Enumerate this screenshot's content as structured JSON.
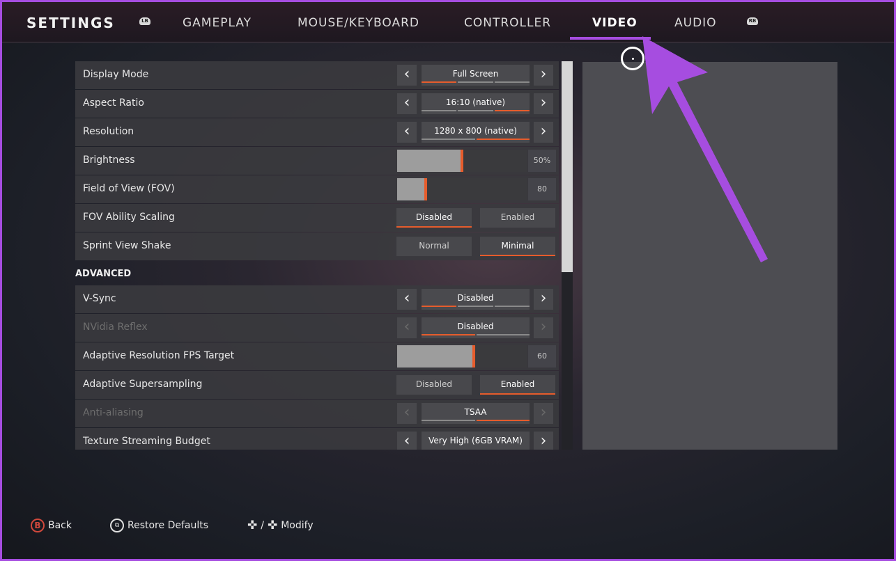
{
  "header": {
    "title": "SETTINGS",
    "left_bumper": "LB",
    "right_bumper": "RB",
    "tabs": [
      {
        "label": "GAMEPLAY"
      },
      {
        "label": "MOUSE/KEYBOARD"
      },
      {
        "label": "CONTROLLER"
      },
      {
        "label": "VIDEO"
      },
      {
        "label": "AUDIO"
      }
    ],
    "active_tab": "VIDEO"
  },
  "colors": {
    "accent": "#e65c2c",
    "annotation": "#a64de0",
    "row_bg": "#3a3a3e",
    "text": "#e6e6e6"
  },
  "settings": {
    "display_mode": {
      "label": "Display Mode",
      "value": "Full Screen",
      "option_count": 3,
      "selected_index": 0
    },
    "aspect_ratio": {
      "label": "Aspect Ratio",
      "value": "16:10 (native)",
      "option_count": 3,
      "selected_index": 2
    },
    "resolution": {
      "label": "Resolution",
      "value": "1280 x 800 (native)",
      "option_count": 2,
      "selected_index": 1
    },
    "brightness": {
      "label": "Brightness",
      "value": "50%",
      "level": 0.5
    },
    "fov": {
      "label": "Field of View (FOV)",
      "value": "80",
      "level": 0.22
    },
    "fov_scaling": {
      "label": "FOV Ability Scaling",
      "option1": "Disabled",
      "option2": "Enabled",
      "selected": 1
    },
    "sprint_shake": {
      "label": "Sprint View Shake",
      "option1": "Normal",
      "option2": "Minimal",
      "selected": 2
    },
    "advanced_heading": "ADVANCED",
    "vsync": {
      "label": "V-Sync",
      "value": "Disabled",
      "option_count": 3,
      "selected_index": 0
    },
    "nvidia_reflex": {
      "label": "NVidia Reflex",
      "value": "Disabled",
      "option_count": 2,
      "selected_index": 0
    },
    "adaptive_res": {
      "label": "Adaptive Resolution FPS Target",
      "value": "60",
      "level": 0.59
    },
    "adaptive_super": {
      "label": "Adaptive Supersampling",
      "option1": "Disabled",
      "option2": "Enabled",
      "selected": 2
    },
    "anti_aliasing": {
      "label": "Anti-aliasing",
      "value": "TSAA",
      "option_count": 2,
      "selected_index": 1
    },
    "texture_budget": {
      "label": "Texture Streaming Budget",
      "value": "Very High (6GB VRAM)"
    }
  },
  "footer": {
    "back_button": "B",
    "back": "Back",
    "restore": "Restore Defaults",
    "modify": "Modify",
    "modify_sep": "/"
  },
  "scroll": {
    "position": 0.0,
    "visible_fraction": 0.54
  }
}
